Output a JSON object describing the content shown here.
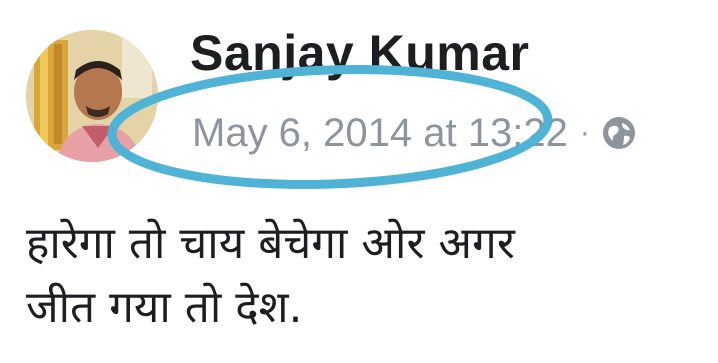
{
  "post": {
    "author": "Sanjay Kumar",
    "timestamp": "May 6, 2014 at 13:22",
    "separator": "·",
    "privacy_icon": "globe-icon",
    "text_lines": [
      "हारेगा तो चाय बेचेगा ओर अगर",
      "जीत गया तो देश."
    ]
  },
  "colors": {
    "highlight_circle": "#4fb3d6",
    "name": "#1c1e21",
    "meta": "#8d949e"
  }
}
